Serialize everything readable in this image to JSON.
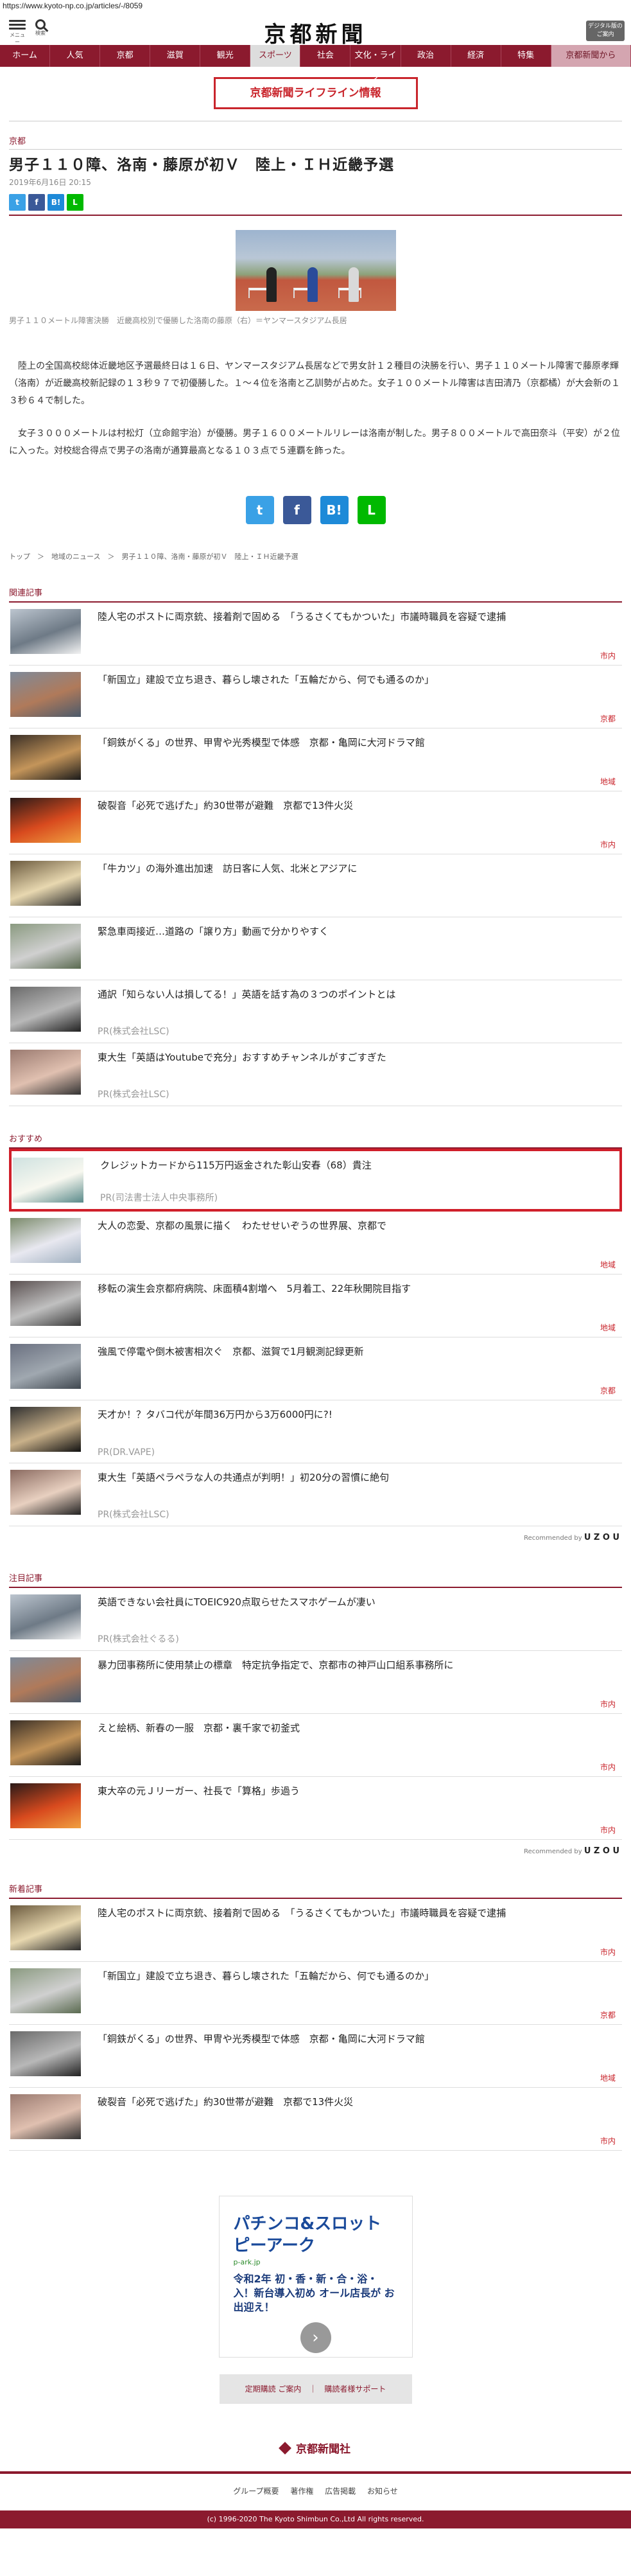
{
  "browser": {
    "url": "https://www.kyoto-np.co.jp/articles/-/8059"
  },
  "header": {
    "menu_label": "メニュー",
    "search_label": "検索",
    "logo": "京都新聞",
    "digital_label": "デジタル版のご案内"
  },
  "nav": [
    {
      "label": "ホーム"
    },
    {
      "label": "人気"
    },
    {
      "label": "京都"
    },
    {
      "label": "滋賀"
    },
    {
      "label": "観光"
    },
    {
      "label": "スポーツ",
      "active": true
    },
    {
      "label": "社会"
    },
    {
      "label": "文化・ライフ"
    },
    {
      "label": "政治"
    },
    {
      "label": "経済"
    },
    {
      "label": "特集"
    },
    {
      "label": "京都新聞から"
    }
  ],
  "lifeline_label": "京都新聞ライフライン情報",
  "article": {
    "category": "京都",
    "title": "男子１１０障、洛南・藤原が初Ｖ　陸上・ＩＨ近畿予選",
    "date": "2019年6月16日 20:15",
    "share": {
      "twitter": "t",
      "facebook": "f",
      "hatena": "B!",
      "line": "L"
    },
    "caption": "男子１１０メートル障害決勝　近畿高校別で優勝した洛南の藤原（右）＝ヤンマースタジアム長居",
    "paragraphs": [
      "陸上の全国高校総体近畿地区予選最終日は１６日、ヤンマースタジアム長居などで男女計１２種目の決勝を行い、男子１１０メートル障害で藤原孝輝（洛南）が近畿高校新記録の１３秒９７で初優勝した。１～４位を洛南と乙訓勢が占めた。女子１００メートル障害は吉田清乃（京都橘）が大会新の１３秒６４で制した。",
      "女子３０００メートルは村松灯（立命館宇治）が優勝。男子１６００メートルリレーは洛南が制した。男子８００メートルで高田奈斗（平安）が２位に入った。対校総合得点で男子の洛南が通算最高となる１０３点で５連覇を飾った。"
    ],
    "breadcrumb": "トップ　＞　地域のニュース　＞　男子１１０障、洛南・藤原が初Ｖ　陸上・ＩＨ近畿予選"
  },
  "related": {
    "heading": "関連記事",
    "items": [
      {
        "title": "陸人宅のポストに両京銃、接着剤で固める　「うるさくてもかついた」市議時職員を容疑で逮捕",
        "tag": "市内"
      },
      {
        "title": "「新国立」建設で立ち退き、暮らし壊された「五輪だから、何でも通るのか」",
        "tag": "京都"
      },
      {
        "title": "「銅鉄がくる」の世界、甲冑や光秀模型で体感　京都・亀岡に大河ドラマ館",
        "tag": "地域"
      },
      {
        "title": "破裂音「必死で逃げた」約30世帯が避難　京都で13件火災",
        "tag": "市内"
      },
      {
        "title": "「牛カツ」の海外進出加速　訪日客に人気、北米とアジアに",
        "tag": ""
      },
      {
        "title": "緊急車両接近…道路の「譲り方」動画で分かりやすく",
        "tag": ""
      },
      {
        "title": "通訳「知らない人は損してる！」英語を話す為の３つのポイントとは",
        "pr": "PR(株式会社LSC)"
      },
      {
        "title": "東大生「英語はYoutubeで充分」おすすめチャンネルがすごすぎた",
        "pr": "PR(株式会社LSC)"
      }
    ]
  },
  "recommend": {
    "heading": "おすすめ",
    "items": [
      {
        "title": "クレジットカードから115万円返金された彰山安春（68）貴注",
        "pr": "PR(司法書士法人中央事務所)",
        "highlight": true
      },
      {
        "title": "大人の恋愛、京都の風景に描く　わたせせいぞうの世界展、京都で",
        "tag": "地域"
      },
      {
        "title": "移転の演生会京都府病院、床面積4割増へ　5月着工、22年秋開院目指す",
        "tag": "地域"
      },
      {
        "title": "強風で停電や倒木被害相次ぐ　京都、滋賀で1月観測記録更新",
        "tag": "京都"
      },
      {
        "title": "天才か！？タバコ代が年間36万円から3万6000円に?!",
        "pr": "PR(DR.VAPE)"
      },
      {
        "title": "東大生「英語ペラペラな人の共通点が判明！」初20分の習慣に絶句",
        "pr": "PR(株式会社LSC)"
      }
    ]
  },
  "recommended_by": {
    "prefix": "Recommended by",
    "brand": "U Z O U"
  },
  "featured": {
    "heading": "注目記事",
    "items": [
      {
        "title": "英語できない会社員にTOEIC920点取らせたスマホゲームが凄い",
        "pr": "PR(株式会社ぐるる)"
      },
      {
        "title": "暴力団事務所に使用禁止の標章　特定抗争指定で、京都市の神戸山口組系事務所に",
        "tag": "市内"
      },
      {
        "title": "えと絵柄、新春の一服　京都・裏千家で初釜式",
        "tag": "市内"
      },
      {
        "title": "東大卒の元Ｊリーガー、社長で「算格」歩過う",
        "tag": "市内"
      }
    ]
  },
  "latest": {
    "heading": "新着記事",
    "items": [
      {
        "title": "陸人宅のポストに両京銃、接着剤で固める　「うるさくてもかついた」市議時職員を容疑で逮捕",
        "tag": "市内"
      },
      {
        "title": "「新国立」建設で立ち退き、暮らし壊された「五輪だから、何でも通るのか」",
        "tag": "京都"
      },
      {
        "title": "「銅鉄がくる」の世界、甲冑や光秀模型で体感　京都・亀岡に大河ドラマ館",
        "tag": "地域"
      },
      {
        "title": "破裂音「必死で逃げた」約30世帯が避難　京都で13件火災",
        "tag": "市内"
      }
    ]
  },
  "ad": {
    "headline": "パチンコ&スロット ピーアーク",
    "sponsor": "p-ark.jp",
    "copy": "令和2年 初・香・新・合・浴・入！新台導入初め オール店長が お出迎え！"
  },
  "footer": {
    "buttons": "定期購読 ご案内　｜　購読者様サポート",
    "logo": "京都新聞社",
    "links": "グループ概要 著作権 広告掲載 お知らせ",
    "copyright": "(c) 1996-2020 The Kyoto Shimbun Co.,Ltd All rights reserved."
  },
  "colors": {
    "brand": "#8b1a2e",
    "alert": "#c9252c",
    "tag": "#c9252c"
  }
}
